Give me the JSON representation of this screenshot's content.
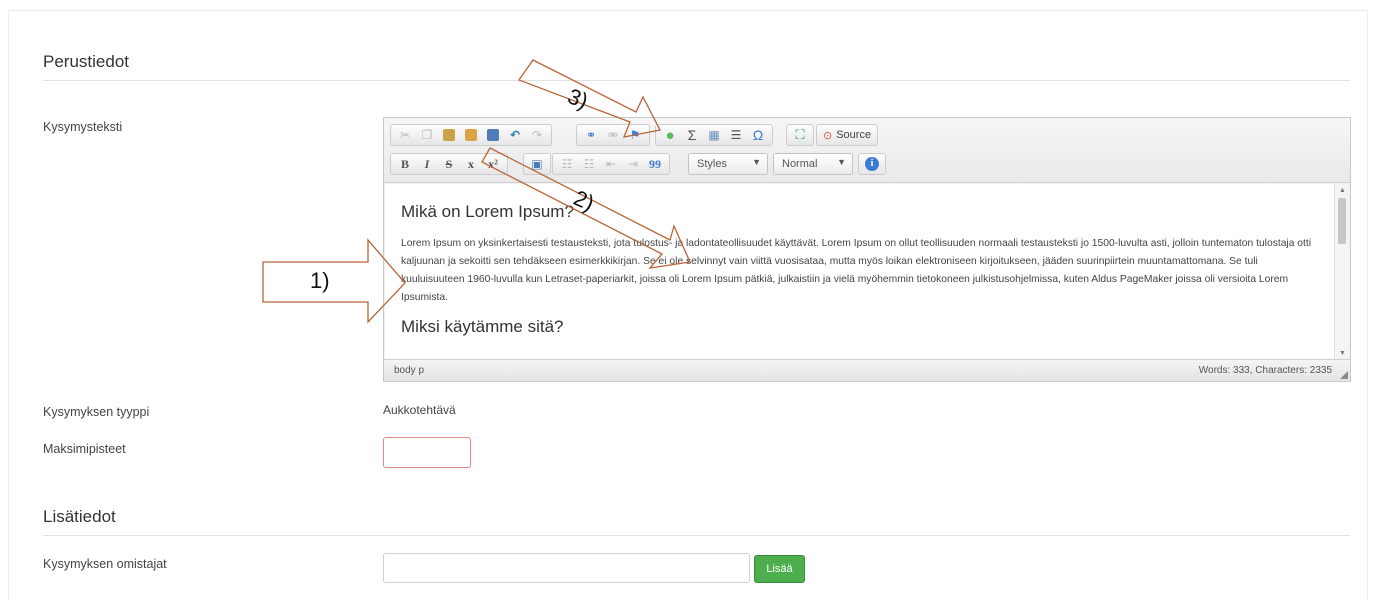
{
  "sections": {
    "basic": "Perustiedot",
    "additional": "Lisätiedot"
  },
  "labels": {
    "question_text": "Kysymysteksti",
    "question_type": "Kysymyksen tyyppi",
    "max_points": "Maksimipisteet",
    "owners": "Kysymyksen omistajat"
  },
  "question_type_value": "Aukkotehtävä",
  "max_points_value": "",
  "owners_value": "",
  "add_button": "Lisää",
  "editor": {
    "toolbar": {
      "source_label": "Source",
      "styles_label": "Styles",
      "format_label": "Normal",
      "bold": "B",
      "italic": "I",
      "strike": "S",
      "subscript": "x",
      "superscript": "x²",
      "sigma": "Σ",
      "omega": "Ω",
      "blockquote": "99"
    },
    "content": {
      "heading1": "Mikä on Lorem Ipsum?",
      "paragraph1": "Lorem Ipsum on yksinkertaisesti testausteksti, jota tulostus- ja ladontateollisuudet käyttävät. Lorem Ipsum on ollut teollisuuden normaali testausteksti jo 1500-luvulta asti, jolloin tuntematon tulostaja otti kaljuunan ja sekoitti sen tehdäkseen esimerkkikirjan. Se ei ole selvinnyt vain viittä vuosisataa, mutta myös loikan elektroniseen kirjoitukseen, jääden suurinpiirtein muuntamattomana. Se tuli kuuluisuuteen 1960-luvulla kun Letraset-paperiarkit, joissa oli Lorem Ipsum pätkiä, julkaistiin ja vielä myöhemmin tietokoneen julkistusohjelmissa, kuten Aldus PageMaker joissa oli versioita Lorem Ipsumista.",
      "heading2": "Miksi käytämme sitä?"
    },
    "status": {
      "path": "body  p",
      "counts": "Words: 333, Characters: 2335"
    }
  },
  "annotations": [
    "1)",
    "2)",
    "3)"
  ],
  "colors": {
    "add_button": "#4cae4c",
    "invalid_border": "#e2868d",
    "annotation_stroke": "#b8653a",
    "speech_bubble": "#5cb85c",
    "info_icon": "#3a7bd5",
    "fullscreen_icon": "#3c9a3c",
    "source_icon": "#d9534f"
  }
}
